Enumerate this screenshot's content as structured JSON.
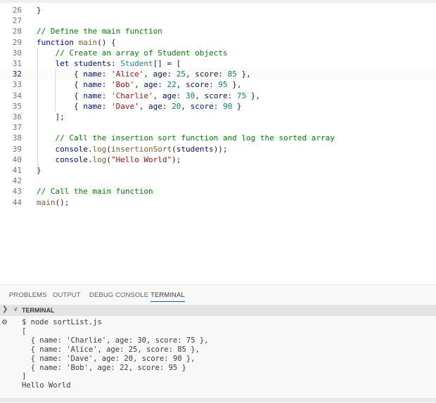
{
  "editor": {
    "current_line": 32,
    "lines": [
      {
        "n": "26",
        "tokens": [
          [
            "}",
            "p"
          ]
        ]
      },
      {
        "n": "27",
        "tokens": []
      },
      {
        "n": "28",
        "tokens": [
          [
            "// Define the main function",
            "com"
          ]
        ]
      },
      {
        "n": "29",
        "tokens": [
          [
            "function",
            "kw"
          ],
          [
            " ",
            "p"
          ],
          [
            "main",
            "fn"
          ],
          [
            "() {",
            "p"
          ]
        ]
      },
      {
        "n": "30",
        "tokens": [
          [
            "    // Create an array of Student objects",
            "com"
          ]
        ]
      },
      {
        "n": "31",
        "tokens": [
          [
            "    ",
            "p"
          ],
          [
            "let",
            "kw"
          ],
          [
            " ",
            "p"
          ],
          [
            "students",
            "var"
          ],
          [
            ": ",
            "p"
          ],
          [
            "Student",
            "type"
          ],
          [
            "[] = [",
            "p"
          ]
        ]
      },
      {
        "n": "32",
        "tokens": [
          [
            "        { ",
            "p"
          ],
          [
            "name",
            "var"
          ],
          [
            ": ",
            "p"
          ],
          [
            "'Alice'",
            "str"
          ],
          [
            ", ",
            "p"
          ],
          [
            "age",
            "var"
          ],
          [
            ": ",
            "p"
          ],
          [
            "25",
            "num"
          ],
          [
            ", ",
            "p"
          ],
          [
            "score",
            "var"
          ],
          [
            ": ",
            "p"
          ],
          [
            "85",
            "num"
          ],
          [
            " },",
            "p"
          ]
        ]
      },
      {
        "n": "33",
        "tokens": [
          [
            "        { ",
            "p"
          ],
          [
            "name",
            "var"
          ],
          [
            ": ",
            "p"
          ],
          [
            "'Bob'",
            "str"
          ],
          [
            ", ",
            "p"
          ],
          [
            "age",
            "var"
          ],
          [
            ": ",
            "p"
          ],
          [
            "22",
            "num"
          ],
          [
            ", ",
            "p"
          ],
          [
            "score",
            "var"
          ],
          [
            ": ",
            "p"
          ],
          [
            "95",
            "num"
          ],
          [
            " },",
            "p"
          ]
        ]
      },
      {
        "n": "34",
        "tokens": [
          [
            "        { ",
            "p"
          ],
          [
            "name",
            "var"
          ],
          [
            ": ",
            "p"
          ],
          [
            "'Charlie'",
            "str"
          ],
          [
            ", ",
            "p"
          ],
          [
            "age",
            "var"
          ],
          [
            ": ",
            "p"
          ],
          [
            "30",
            "num"
          ],
          [
            ", ",
            "p"
          ],
          [
            "score",
            "var"
          ],
          [
            ": ",
            "p"
          ],
          [
            "75",
            "num"
          ],
          [
            " },",
            "p"
          ]
        ]
      },
      {
        "n": "35",
        "tokens": [
          [
            "        { ",
            "p"
          ],
          [
            "name",
            "var"
          ],
          [
            ": ",
            "p"
          ],
          [
            "'Dave'",
            "str"
          ],
          [
            ", ",
            "p"
          ],
          [
            "age",
            "var"
          ],
          [
            ": ",
            "p"
          ],
          [
            "20",
            "num"
          ],
          [
            ", ",
            "p"
          ],
          [
            "score",
            "var"
          ],
          [
            ": ",
            "p"
          ],
          [
            "90",
            "num"
          ],
          [
            " }",
            "p"
          ]
        ]
      },
      {
        "n": "36",
        "tokens": [
          [
            "    ];",
            "p"
          ]
        ]
      },
      {
        "n": "37",
        "tokens": []
      },
      {
        "n": "38",
        "tokens": [
          [
            "    // Call the insertion sort function and log the sorted array",
            "com"
          ]
        ]
      },
      {
        "n": "39",
        "tokens": [
          [
            "    ",
            "p"
          ],
          [
            "console",
            "var"
          ],
          [
            ".",
            "p"
          ],
          [
            "log",
            "fn"
          ],
          [
            "(",
            "p"
          ],
          [
            "insertionSort",
            "fn"
          ],
          [
            "(",
            "p"
          ],
          [
            "students",
            "var"
          ],
          [
            "));",
            "p"
          ]
        ]
      },
      {
        "n": "40",
        "tokens": [
          [
            "    ",
            "p"
          ],
          [
            "console",
            "var"
          ],
          [
            ".",
            "p"
          ],
          [
            "log",
            "fn"
          ],
          [
            "(",
            "p"
          ],
          [
            "\"Hello World\"",
            "str"
          ],
          [
            ");",
            "p"
          ]
        ]
      },
      {
        "n": "41",
        "tokens": [
          [
            "}",
            "p"
          ]
        ]
      },
      {
        "n": "42",
        "tokens": []
      },
      {
        "n": "43",
        "tokens": [
          [
            "// Call the main function",
            "com"
          ]
        ]
      },
      {
        "n": "44",
        "tokens": [
          [
            "main",
            "fn"
          ],
          [
            "();",
            "p"
          ]
        ]
      }
    ]
  },
  "panel": {
    "tabs": [
      {
        "label": "PROBLEMS",
        "active": false
      },
      {
        "label": "OUTPUT",
        "active": false
      },
      {
        "label": "DEBUG CONSOLE",
        "active": false
      },
      {
        "label": "TERMINAL",
        "active": true
      }
    ],
    "section_title": "TERMINAL",
    "icons": {
      "collapse": "chevron-right-icon",
      "expand": "chevron-down-icon",
      "terminal": "settings-gear-icon"
    },
    "terminal_lines": [
      "$ node sortList.js",
      "[",
      "  { name: 'Charlie', age: 30, score: 75 },",
      "  { name: 'Alice', age: 25, score: 85 },",
      "  { name: 'Dave', age: 20, score: 90 },",
      "  { name: 'Bob', age: 22, score: 95 }",
      "]",
      "Hello World"
    ]
  }
}
